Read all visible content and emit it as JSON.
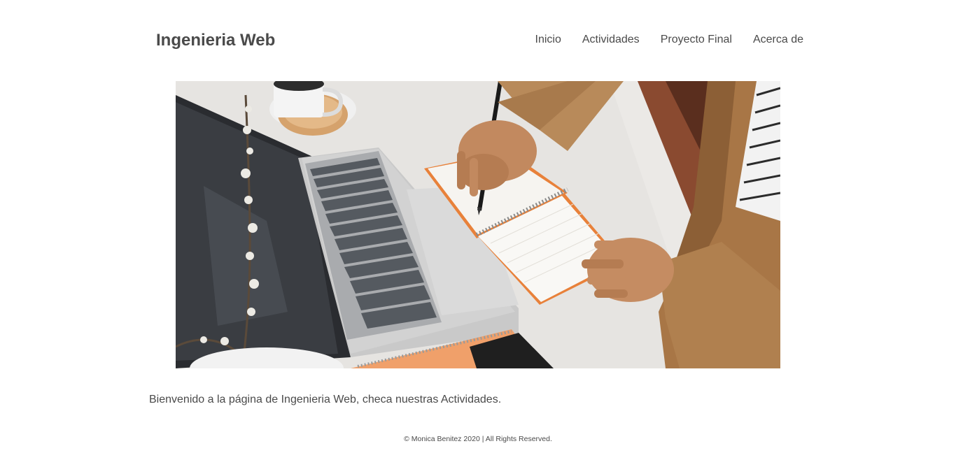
{
  "header": {
    "site_title": "Ingenieria Web",
    "nav": [
      {
        "label": "Inicio"
      },
      {
        "label": "Actividades"
      },
      {
        "label": "Proyecto Final"
      },
      {
        "label": "Acerca de"
      }
    ]
  },
  "hero": {
    "alt": "Persona escribiendo en una libreta junto a una laptop y una taza de café"
  },
  "main": {
    "welcome_text": "Bienvenido a la página de Ingenieria Web, checa nuestras Actividades."
  },
  "footer": {
    "copyright": "© Monica Benitez 2020 | All Rights Reserved."
  }
}
